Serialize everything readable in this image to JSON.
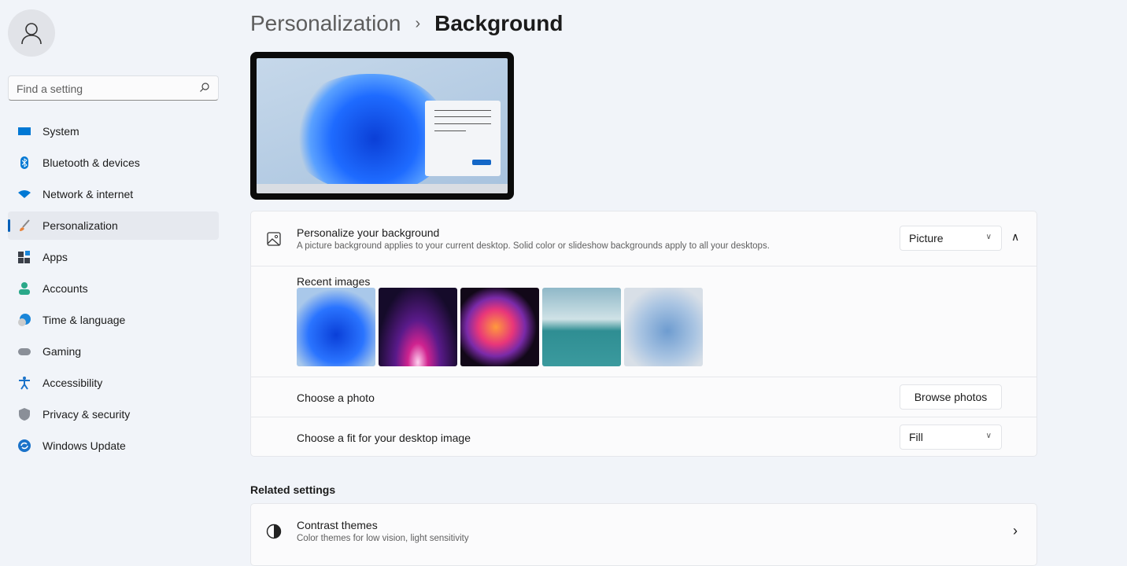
{
  "sidebar": {
    "search_placeholder": "Find a setting",
    "items": [
      {
        "label": "System",
        "icon": "monitor-icon",
        "color": "#0078d4"
      },
      {
        "label": "Bluetooth & devices",
        "icon": "bluetooth-icon",
        "color": "#0078d4"
      },
      {
        "label": "Network & internet",
        "icon": "wifi-icon",
        "color": "#0078d4"
      },
      {
        "label": "Personalization",
        "icon": "brush-icon",
        "color": "#e8833a",
        "active": true
      },
      {
        "label": "Apps",
        "icon": "apps-icon",
        "color": "#3a3f48"
      },
      {
        "label": "Accounts",
        "icon": "person-icon",
        "color": "#2aa889"
      },
      {
        "label": "Time & language",
        "icon": "globe-clock-icon",
        "color": "#1a86d9"
      },
      {
        "label": "Gaming",
        "icon": "gamepad-icon",
        "color": "#8a8f98"
      },
      {
        "label": "Accessibility",
        "icon": "accessibility-icon",
        "color": "#1a72c9"
      },
      {
        "label": "Privacy & security",
        "icon": "shield-icon",
        "color": "#8a8f98"
      },
      {
        "label": "Windows Update",
        "icon": "update-icon",
        "color": "#1a72c9"
      }
    ]
  },
  "header": {
    "breadcrumb_parent": "Personalization",
    "separator": "›",
    "title": "Background"
  },
  "background": {
    "title": "Personalize your background",
    "description": "A picture background applies to your current desktop. Solid color or slideshow backgrounds apply to all your desktops.",
    "type_value": "Picture",
    "recent_label": "Recent images",
    "recent_images": [
      "Blue bloom",
      "Purple glow",
      "Colorful ribbons",
      "Lake sunrise",
      "Pale bloom"
    ],
    "choose_photo_label": "Choose a photo",
    "browse_button": "Browse photos",
    "fit_label": "Choose a fit for your desktop image",
    "fit_value": "Fill"
  },
  "related": {
    "heading": "Related settings",
    "items": [
      {
        "title": "Contrast themes",
        "description": "Color themes for low vision, light sensitivity"
      }
    ]
  },
  "colors": {
    "accent": "#005fb8"
  }
}
